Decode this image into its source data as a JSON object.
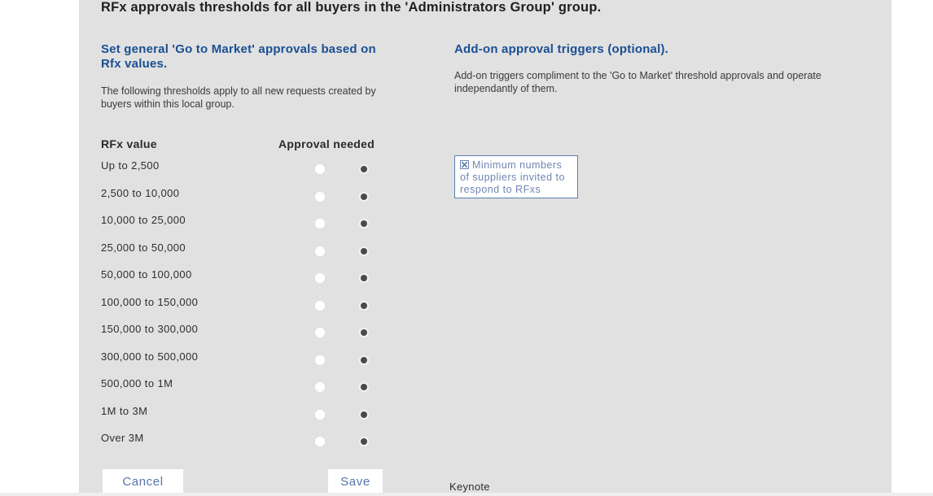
{
  "page": {
    "title": "RFx approvals thresholds for all buyers in the 'Administrators Group' group."
  },
  "left_section": {
    "heading": "Set general 'Go to Market' approvals based on Rfx values.",
    "description": "The following thresholds apply to all new requests created by buyers within this local group.",
    "col_rfx_value": "RFx value",
    "col_approval_needed": "Approval needed",
    "thresholds": [
      {
        "label": "Up to 2,500",
        "approval_selected": true
      },
      {
        "label": "2,500 to 10,000",
        "approval_selected": true
      },
      {
        "label": "10,000 to 25,000",
        "approval_selected": true
      },
      {
        "label": "25,000 to 50,000",
        "approval_selected": true
      },
      {
        "label": "50,000 to 100,000",
        "approval_selected": true
      },
      {
        "label": "100,000 to 150,000",
        "approval_selected": true
      },
      {
        "label": "150,000 to 300,000",
        "approval_selected": true
      },
      {
        "label": "300,000 to 500,000",
        "approval_selected": true
      },
      {
        "label": "500,000 to 1M",
        "approval_selected": true
      },
      {
        "label": "1M to 3M",
        "approval_selected": true
      },
      {
        "label": "Over 3M",
        "approval_selected": true
      }
    ]
  },
  "right_section": {
    "heading": "Add-on approval triggers (optional).",
    "description": "Add-on triggers compliment to the 'Go to Market' threshold approvals and operate independantly of them.",
    "trigger_label": "Minimum numbers of suppliers invited to respond to RFxs",
    "trigger_checked": true
  },
  "actions": {
    "cancel_label": "Cancel",
    "save_label": "Save"
  },
  "footer": {
    "text": "Keynote"
  },
  "colors": {
    "panel_bg": "#e1e1e1",
    "heading_blue": "#1a4f93",
    "button_text": "#5775ab",
    "radio_dot": "#4a4a4a"
  }
}
